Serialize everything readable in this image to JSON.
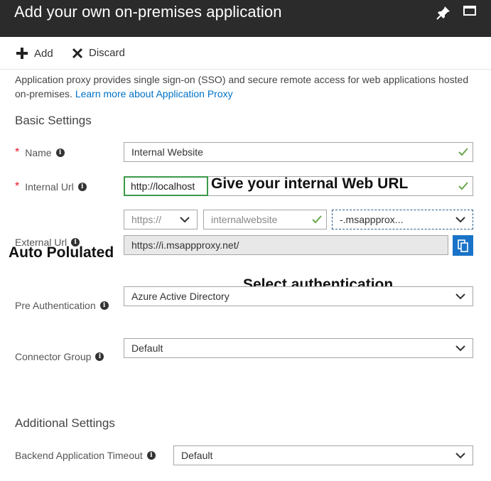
{
  "header": {
    "title": "Add your own on-premises application"
  },
  "toolbar": {
    "add_label": "Add",
    "discard_label": "Discard"
  },
  "description": {
    "text": "Application proxy provides single sign-on (SSO) and secure remote access for web applications hosted on-premises.",
    "link": "Learn more about Application Proxy"
  },
  "basic": {
    "title": "Basic Settings",
    "name_label": "Name",
    "name_value": "Internal Website",
    "internal_url_label": "Internal Url",
    "internal_url_value": "http://localhost",
    "scheme_value": "https://",
    "subdomain_value": "internalwebsite",
    "domain_value": "-.msappprox...",
    "external_url_label": "External Url",
    "external_url_value": "https://i.msappproxy.net/",
    "pre_auth_label": "Pre Authentication",
    "pre_auth_value": "Azure Active Directory",
    "connector_label": "Connector Group",
    "connector_value": "Default"
  },
  "additional": {
    "title": "Additional Settings",
    "timeout_label": "Backend Application Timeout",
    "timeout_value": "Default"
  },
  "annotations": {
    "internal_url": "Give your internal Web URL",
    "auto": "Auto Polulated",
    "auth": "Select authentication"
  },
  "colors": {
    "titlebar": "#2b2b2b",
    "link": "#0072c6",
    "required": "#e81123",
    "check": "#6aa84f",
    "highlight": "#3a9a4a",
    "copy_button": "#1a73c8"
  },
  "icons": [
    "pin-icon",
    "maximize-icon",
    "plus-icon",
    "close-icon",
    "info-icon",
    "check-icon",
    "chevron-down-icon",
    "copy-icon"
  ]
}
